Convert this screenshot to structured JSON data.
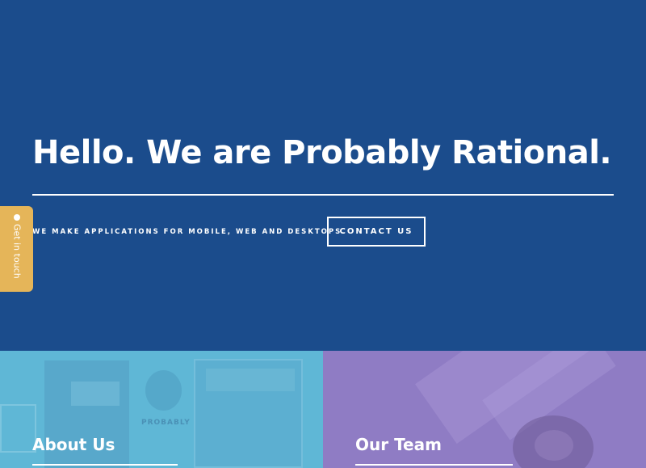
{
  "hero": {
    "title": "Hello. We are Probably Rational.",
    "tagline": "WE MAKE APPLICATIONS FOR MOBILE, WEB AND DESKTOPS.",
    "contact_label": "CONTACT US"
  },
  "side_tab": {
    "label": "Get in touch",
    "icon": "chat-bubble-icon"
  },
  "panels": [
    {
      "title": "About Us",
      "background_image_text": "PROBABLY"
    },
    {
      "title": "Our Team"
    }
  ],
  "colors": {
    "hero_bg": "#1b4c8c",
    "side_tab": "#e5b559",
    "about_bg": "#5fb7d6",
    "team_bg": "#8f7cc4",
    "text": "#ffffff"
  }
}
